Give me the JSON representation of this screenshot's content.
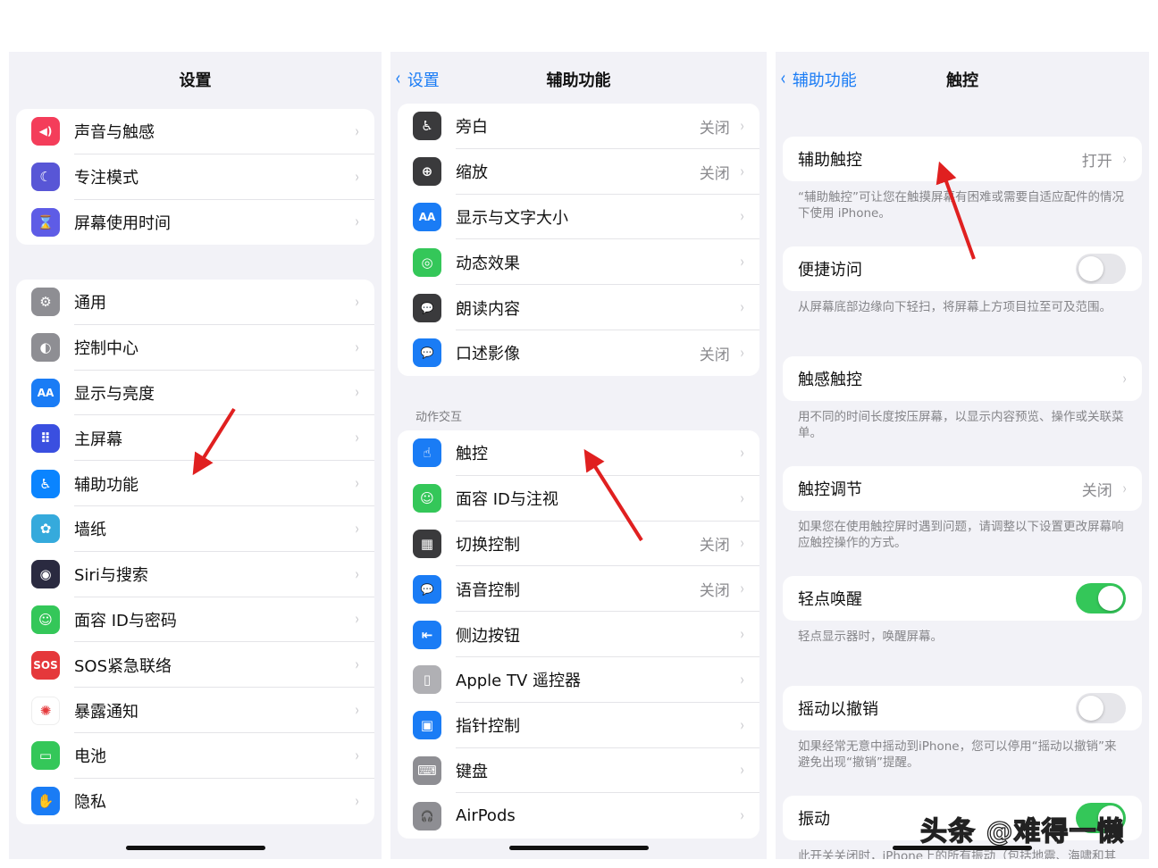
{
  "panel1": {
    "title": "设置",
    "groups": [
      [
        {
          "label": "声音与触感",
          "icon": "speaker-icon",
          "color": "#f43d5a",
          "glyph": "◀)"
        },
        {
          "label": "专注模式",
          "icon": "moon-icon",
          "color": "#5856d6",
          "glyph": "☾"
        },
        {
          "label": "屏幕使用时间",
          "icon": "hourglass-icon",
          "color": "#5e5ce6",
          "glyph": "⌛"
        }
      ],
      [
        {
          "label": "通用",
          "icon": "gear-icon",
          "color": "#8e8e93",
          "glyph": "⚙"
        },
        {
          "label": "控制中心",
          "icon": "toggles-icon",
          "color": "#8e8e93",
          "glyph": "◐"
        },
        {
          "label": "显示与亮度",
          "icon": "text-size-icon",
          "color": "#1a7cf5",
          "glyph": "AA"
        },
        {
          "label": "主屏幕",
          "icon": "home-screen-icon",
          "color": "#3a4fe0",
          "glyph": "⠿"
        },
        {
          "label": "辅助功能",
          "icon": "accessibility-icon",
          "color": "#0a84ff",
          "glyph": "♿"
        },
        {
          "label": "墙纸",
          "icon": "flower-icon",
          "color": "#35aadc",
          "glyph": "✿"
        },
        {
          "label": "Siri与搜索",
          "icon": "siri-icon",
          "color": "#2a2a40",
          "glyph": "◉"
        },
        {
          "label": "面容 ID与密码",
          "icon": "face-id-icon",
          "color": "#34c759",
          "glyph": "☺"
        },
        {
          "label": "SOS紧急联络",
          "icon": "sos-icon",
          "color": "#e5383b",
          "glyph": "SOS"
        },
        {
          "label": "暴露通知",
          "icon": "exposure-icon",
          "color": "#ffffff",
          "glyph": "✺",
          "fg": "#e5383b"
        },
        {
          "label": "电池",
          "icon": "battery-icon",
          "color": "#34c759",
          "glyph": "▭"
        },
        {
          "label": "隐私",
          "icon": "hand-icon",
          "color": "#1a7cf5",
          "glyph": "✋"
        }
      ]
    ]
  },
  "panel2": {
    "back": "设置",
    "title": "辅助功能",
    "section": "动作交互",
    "groups": [
      [
        {
          "label": "旁白",
          "value": "关闭",
          "icon": "voiceover-icon",
          "color": "#3a3a3c",
          "glyph": "♿"
        },
        {
          "label": "缩放",
          "value": "关闭",
          "icon": "zoom-icon",
          "color": "#3a3a3c",
          "glyph": "⊕"
        },
        {
          "label": "显示与文字大小",
          "icon": "text-size-icon",
          "color": "#1a7cf5",
          "glyph": "AA"
        },
        {
          "label": "动态效果",
          "icon": "motion-icon",
          "color": "#34c759",
          "glyph": "◎"
        },
        {
          "label": "朗读内容",
          "icon": "speech-bubble-icon",
          "color": "#3a3a3c",
          "glyph": "💬"
        },
        {
          "label": "口述影像",
          "value": "关闭",
          "icon": "audio-description-icon",
          "color": "#1a7cf5",
          "glyph": "💬"
        }
      ],
      [
        {
          "label": "触控",
          "icon": "hand-tap-icon",
          "color": "#1a7cf5",
          "glyph": "☝"
        },
        {
          "label": "面容 ID与注视",
          "icon": "face-id-icon",
          "color": "#34c759",
          "glyph": "☺"
        },
        {
          "label": "切换控制",
          "value": "关闭",
          "icon": "switch-control-icon",
          "color": "#3a3a3c",
          "glyph": "▦"
        },
        {
          "label": "语音控制",
          "value": "关闭",
          "icon": "voice-control-icon",
          "color": "#1a7cf5",
          "glyph": "💬"
        },
        {
          "label": "侧边按钮",
          "icon": "side-button-icon",
          "color": "#1a7cf5",
          "glyph": "⇤"
        },
        {
          "label": "Apple TV 遥控器",
          "icon": "remote-icon",
          "color": "#b0b0b4",
          "glyph": "▯"
        },
        {
          "label": "指针控制",
          "icon": "pointer-icon",
          "color": "#1a7cf5",
          "glyph": "▣"
        },
        {
          "label": "键盘",
          "icon": "keyboard-icon",
          "color": "#8e8e93",
          "glyph": "⌨"
        },
        {
          "label": "AirPods",
          "icon": "headphones-icon",
          "color": "#8e8e93",
          "glyph": "🎧"
        }
      ]
    ]
  },
  "panel3": {
    "back": "辅助功能",
    "title": "触控",
    "items": [
      {
        "label": "辅助触控",
        "value": "打开",
        "chevron": true,
        "desc": "“辅助触控”可让您在触摸屏幕有困难或需要自适应配件的情况下使用 iPhone。"
      },
      {
        "label": "便捷访问",
        "toggle": false,
        "desc": "从屏幕底部边缘向下轻扫，将屏幕上方项目拉至可及范围。"
      },
      {
        "label": "触感触控",
        "chevron": true,
        "desc": "用不同的时间长度按压屏幕，以显示内容预览、操作或关联菜单。"
      },
      {
        "label": "触控调节",
        "value": "关闭",
        "chevron": true,
        "desc": "如果您在使用触控屏时遇到问题，请调整以下设置更改屏幕响应触控操作的方式。"
      },
      {
        "label": "轻点唤醒",
        "toggle": true,
        "desc": "轻点显示器时，唤醒屏幕。"
      },
      {
        "label": "摇动以撤销",
        "toggle": false,
        "desc": "如果经常无意中摇动到iPhone，您可以停用“摇动以撤销”来避免出现“撤销”提醒。"
      },
      {
        "label": "振动",
        "toggle": true,
        "desc": "此开关关闭时，iPhone上的所有振动（包括地震、海啸和其他紧急警报在内的振动）将全部停用。"
      }
    ]
  },
  "chevron": "›",
  "back_chevron": "‹",
  "watermark": "头条 @难得一懒",
  "colors": {
    "accent": "#1a7cf5",
    "toggle_on": "#34c759",
    "arrow": "#e02020"
  }
}
